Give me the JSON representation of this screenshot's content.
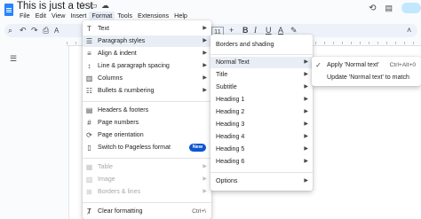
{
  "document": {
    "title": "This is just a test"
  },
  "menubar": [
    "File",
    "Edit",
    "View",
    "Insert",
    "Format",
    "Tools",
    "Extensions",
    "Help"
  ],
  "toolbar": {
    "font_size": "11"
  },
  "format_menu": {
    "group1": [
      {
        "label": "Text",
        "icon": "text-icon"
      },
      {
        "label": "Paragraph styles",
        "icon": "paragraph-styles-icon"
      },
      {
        "label": "Align & indent",
        "icon": "align-icon"
      },
      {
        "label": "Line & paragraph spacing",
        "icon": "line-spacing-icon"
      },
      {
        "label": "Columns",
        "icon": "columns-icon"
      },
      {
        "label": "Bullets & numbering",
        "icon": "bullets-icon"
      }
    ],
    "group2": [
      {
        "label": "Headers & footers",
        "icon": "header-footer-icon"
      },
      {
        "label": "Page numbers",
        "icon": "page-numbers-icon"
      },
      {
        "label": "Page orientation",
        "icon": "page-orientation-icon"
      },
      {
        "label": "Switch to Pageless format",
        "icon": "pageless-icon",
        "badge": "New"
      }
    ],
    "group3": [
      {
        "label": "Table",
        "icon": "table-icon"
      },
      {
        "label": "Image",
        "icon": "image-icon"
      },
      {
        "label": "Borders & lines",
        "icon": "borders-icon"
      }
    ],
    "group4": [
      {
        "label": "Clear formatting",
        "icon": "clear-formatting-icon",
        "shortcut": "Ctrl+\\"
      }
    ]
  },
  "paragraph_styles_menu": {
    "borders": "Borders and shading",
    "styles": [
      "Normal Text",
      "Title",
      "Subtitle",
      "Heading 1",
      "Heading 2",
      "Heading 3",
      "Heading 4",
      "Heading 5",
      "Heading 6"
    ],
    "options": "Options"
  },
  "normal_text_menu": {
    "apply": "Apply 'Normal text'",
    "apply_shortcut": "Ctrl+Alt+0",
    "update": "Update 'Normal text' to match"
  }
}
